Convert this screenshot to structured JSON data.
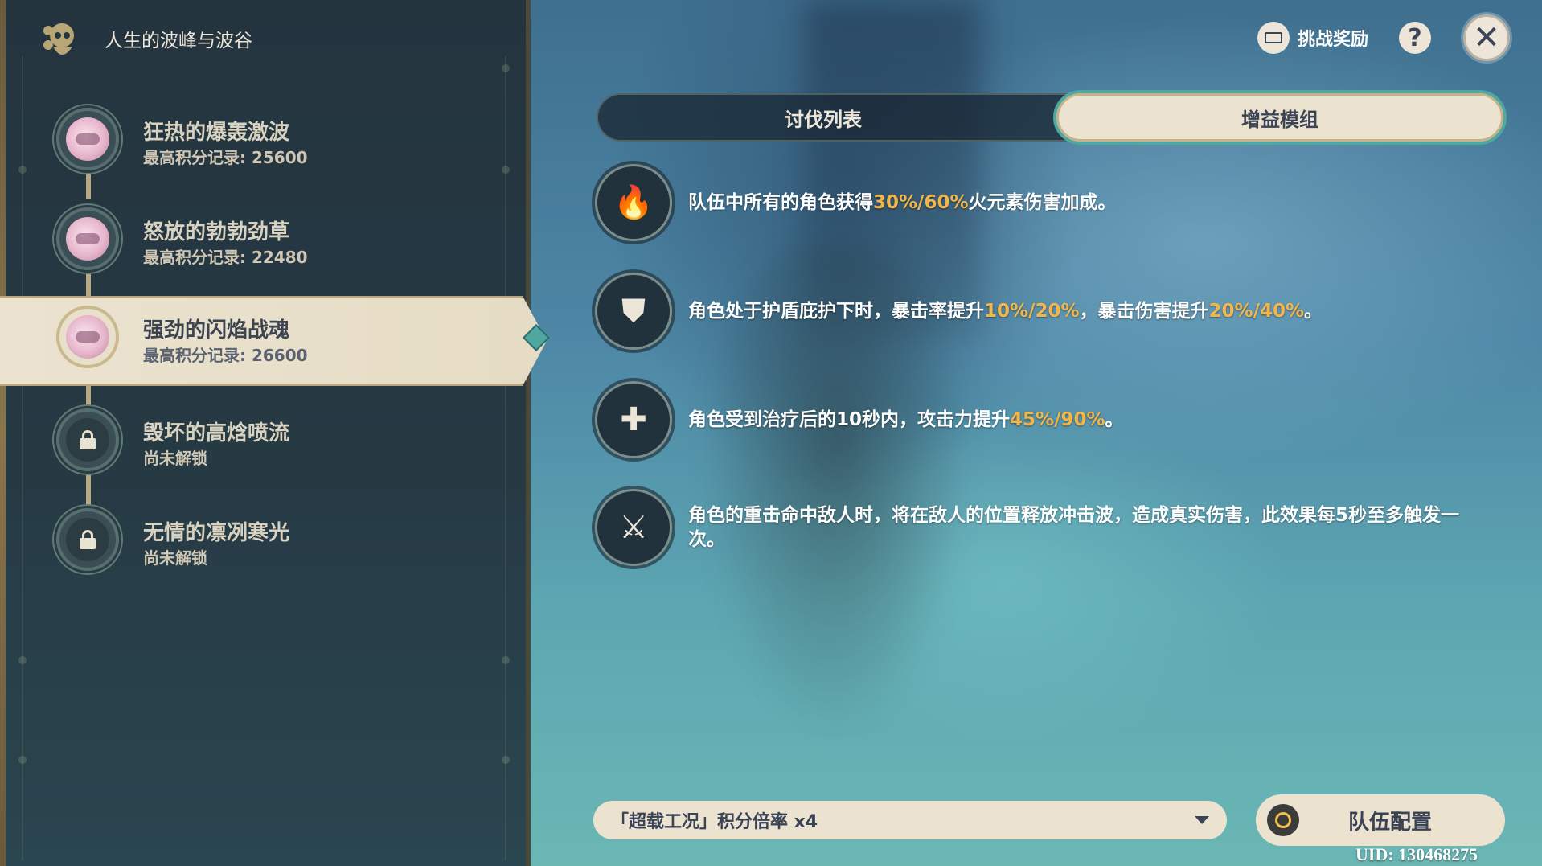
{
  "side": {
    "title": "人生的波峰与波谷",
    "logo_icon": "paimon-icon",
    "entries": [
      {
        "name": "狂热的爆轰激波",
        "sub": "最高积分记录: 25600",
        "locked": false,
        "selected": false
      },
      {
        "name": "怒放的勃勃劲草",
        "sub": "最高积分记录: 22480",
        "locked": false,
        "selected": false
      },
      {
        "name": "强劲的闪焰战魂",
        "sub": "最高积分记录: 26600",
        "locked": false,
        "selected": true
      },
      {
        "name": "毁坏的高焓喷流",
        "sub": "尚未解锁",
        "locked": true,
        "selected": false
      },
      {
        "name": "无情的凛冽寒光",
        "sub": "尚未解锁",
        "locked": true,
        "selected": false
      }
    ]
  },
  "topbar": {
    "reward_label": "挑战奖励",
    "help_label": "?",
    "close_label": "✕"
  },
  "tabs": [
    {
      "label": "讨伐列表",
      "active": false
    },
    {
      "label": "增益模组",
      "active": true
    }
  ],
  "buffs": [
    {
      "icon": "pyro-icon",
      "glyph": "🔥",
      "parts": [
        {
          "t": "队伍中所有的角色获得",
          "hl": false
        },
        {
          "t": "30%/60%",
          "hl": true
        },
        {
          "t": "火元素伤害加成。",
          "hl": false
        }
      ]
    },
    {
      "icon": "shield-crit-icon",
      "glyph": "⛊",
      "parts": [
        {
          "t": "角色处于护盾庇护下时，暴击率提升",
          "hl": false
        },
        {
          "t": "10%/20%",
          "hl": true
        },
        {
          "t": "，暴击伤害提升",
          "hl": false
        },
        {
          "t": "20%/40%",
          "hl": true
        },
        {
          "t": "。",
          "hl": false
        }
      ]
    },
    {
      "icon": "healing-drop-icon",
      "glyph": "✚",
      "parts": [
        {
          "t": "角色受到治疗后的10秒内，攻击力提升",
          "hl": false
        },
        {
          "t": "45%/90%",
          "hl": true
        },
        {
          "t": "。",
          "hl": false
        }
      ]
    },
    {
      "icon": "sword-shockwave-icon",
      "glyph": "⚔",
      "parts": [
        {
          "t": "角色的重击命中敌人时，将在敌人的位置释放冲击波，造成真实伤害，此效果每5秒至多触发一次。",
          "hl": false
        }
      ]
    }
  ],
  "bottom": {
    "dropdown_value": "「超载工况」积分倍率 x4",
    "team_label": "队伍配置",
    "uid": "UID: 130468275"
  },
  "colors": {
    "highlight": "#f2b54a",
    "accent_teal": "#4fa8a0",
    "panel_bg": "#24343f",
    "cream": "#ebe3d0"
  }
}
